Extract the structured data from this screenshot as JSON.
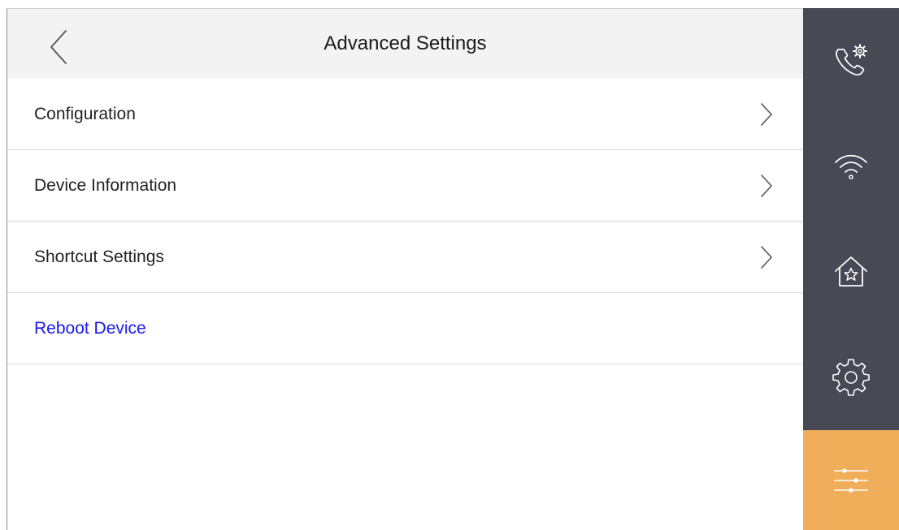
{
  "header": {
    "title": "Advanced Settings",
    "back_icon": "chevron-left-icon"
  },
  "menu": {
    "items": [
      {
        "label": "Configuration",
        "kind": "nav",
        "icon": "chevron-right-icon"
      },
      {
        "label": "Device Information",
        "kind": "nav",
        "icon": "chevron-right-icon"
      },
      {
        "label": "Shortcut Settings",
        "kind": "nav",
        "icon": "chevron-right-icon"
      },
      {
        "label": "Reboot Device",
        "kind": "action"
      }
    ]
  },
  "sidebar": {
    "items": [
      {
        "icon": "call-settings-icon",
        "active": false
      },
      {
        "icon": "wifi-icon",
        "active": false
      },
      {
        "icon": "home-star-icon",
        "active": false
      },
      {
        "icon": "gear-icon",
        "active": false
      },
      {
        "icon": "sliders-icon",
        "active": true
      }
    ]
  },
  "colors": {
    "header_bg": "#f3f3f3",
    "sidebar_bg": "#474a55",
    "sidebar_active_bg": "#f0ae5b",
    "action_text": "#1a1aef",
    "divider": "#dcdcdc"
  }
}
